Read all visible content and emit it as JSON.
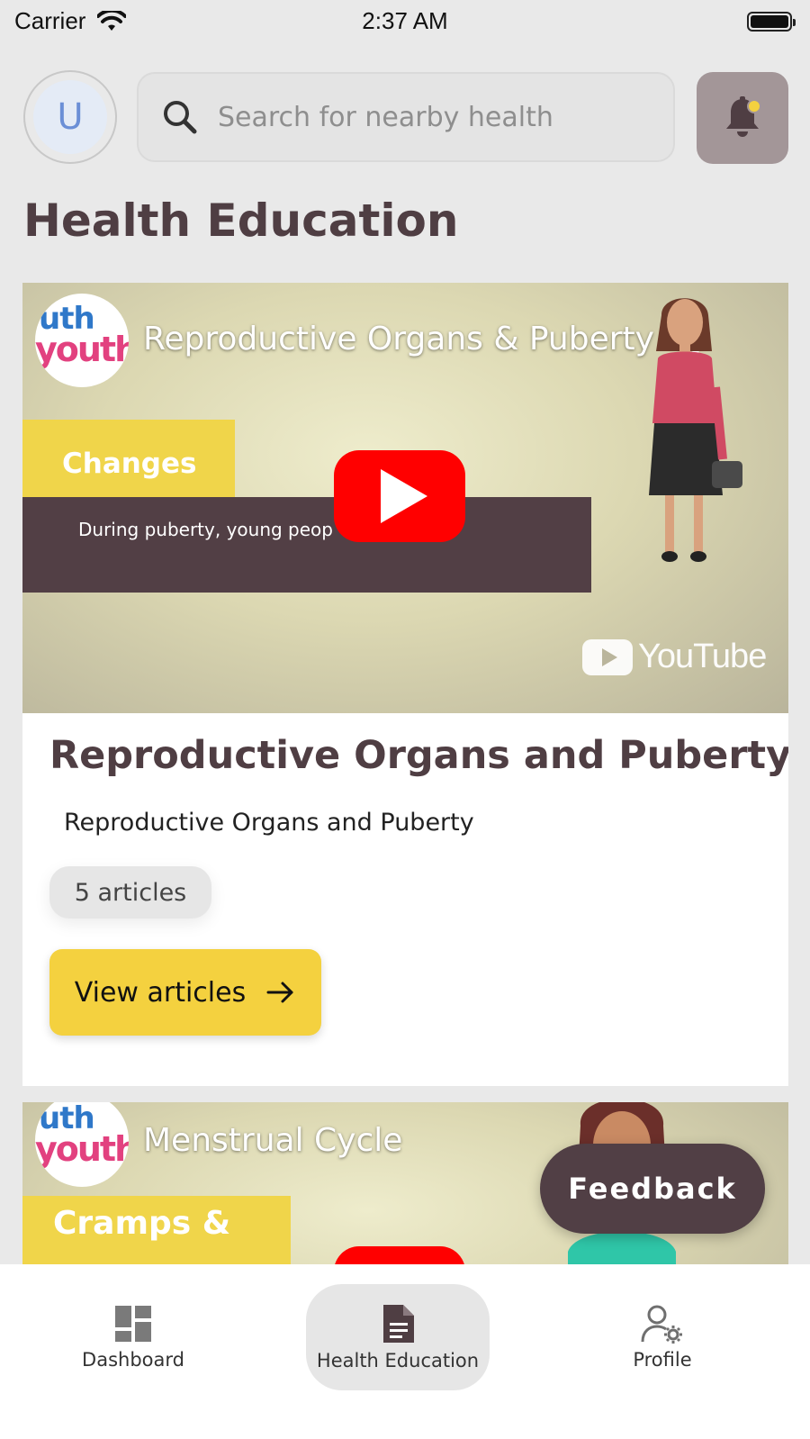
{
  "status_bar": {
    "carrier": "Carrier",
    "time": "2:37 AM"
  },
  "header": {
    "avatar_initial": "U",
    "search_placeholder": "Search for nearby health",
    "notification_icon": "bell-icon"
  },
  "page": {
    "title": "Health Education"
  },
  "cards": [
    {
      "video_title": "Reproductive Organs & Puberty",
      "video_banner_label": "Changes",
      "video_caption": "During puberty, young peop",
      "channel_logo_text_1": "uth",
      "channel_logo_text_2": "youth",
      "youtube_text": "YouTube",
      "title": "Reproductive Organs and Puberty",
      "subtitle": "Reproductive Organs and Puberty",
      "badge": "5 articles",
      "button_label": "View articles",
      "button_icon": "arrow-right-icon"
    },
    {
      "video_title": "Menstrual Cycle",
      "video_banner_label": "Cramps &",
      "channel_logo_text_1": "uth",
      "channel_logo_text_2": "youth"
    }
  ],
  "feedback": {
    "label": "Feedback"
  },
  "bottom_nav": {
    "items": [
      {
        "label": "Dashboard",
        "icon": "dashboard-icon",
        "active": false
      },
      {
        "label": "Health Education",
        "icon": "document-icon",
        "active": true
      },
      {
        "label": "Profile",
        "icon": "user-settings-icon",
        "active": false
      }
    ]
  },
  "colors": {
    "background": "#e9e9e9",
    "primary_dark": "#513f45",
    "accent_yellow": "#f4d13f",
    "bell_button": "#a39698",
    "youtube_red": "#ff0000"
  }
}
